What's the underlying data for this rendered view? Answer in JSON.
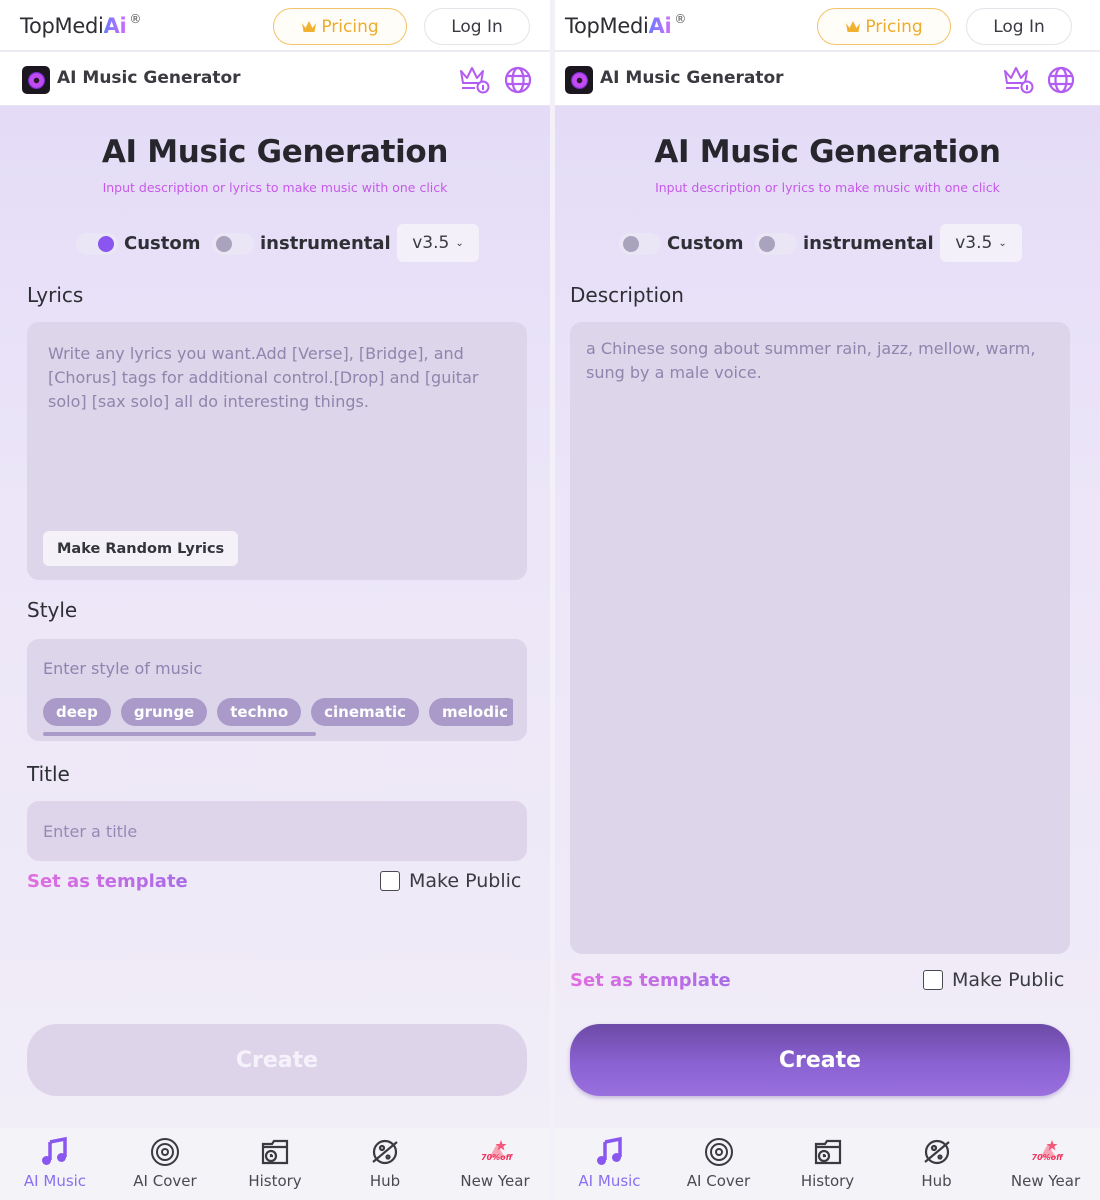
{
  "colors": {
    "accent": "#8a56f0",
    "pricing": "#eeab2e",
    "subtitle": "#c55ae8",
    "icon_purple": "#b35cf0",
    "promo_red": "#f0335c"
  },
  "header": {
    "logo_text": "TopMedi",
    "logo_ai": "Ai",
    "logo_mark": "®",
    "pricing_icon": "crown-icon",
    "pricing_label": "Pricing",
    "login_label": "Log In",
    "app_title": "AI Music Generator",
    "crown_info_icon": "crown-info-icon",
    "language_icon": "globe-icon"
  },
  "page": {
    "title": "AI Music Generation",
    "subtitle": "Input description or lyrics to make music with one click"
  },
  "left": {
    "custom_toggle": {
      "label": "Custom",
      "on": true
    },
    "instrumental_toggle": {
      "label": "instrumental",
      "on": false
    },
    "version": {
      "selected": "v3.5",
      "chevron": "⌄"
    },
    "lyrics": {
      "label": "Lyrics",
      "placeholder": "Write any lyrics you want.Add [Verse], [Bridge], and [Chorus] tags for additional control.[Drop] and [guitar solo] [sax solo] all do interesting things.",
      "random_button": "Make Random Lyrics"
    },
    "style": {
      "label": "Style",
      "placeholder": "Enter style of music",
      "chips": [
        "deep",
        "grunge",
        "techno",
        "cinematic",
        "melodic"
      ]
    },
    "title_field": {
      "label": "Title",
      "placeholder": "Enter a title"
    },
    "set_template": "Set as template",
    "make_public": {
      "label": "Make Public",
      "checked": false
    },
    "create_button": {
      "label": "Create",
      "enabled": false
    }
  },
  "right": {
    "custom_toggle": {
      "label": "Custom",
      "on": false
    },
    "instrumental_toggle": {
      "label": "instrumental",
      "on": false
    },
    "version": {
      "selected": "v3.5",
      "chevron": "⌄"
    },
    "description": {
      "label": "Description",
      "value": "a Chinese song about summer rain, jazz, mellow, warm, sung by a male voice."
    },
    "set_template": "Set as template",
    "make_public": {
      "label": "Make Public",
      "checked": false
    },
    "create_button": {
      "label": "Create",
      "enabled": true
    }
  },
  "bottom_nav": {
    "items": [
      {
        "label": "AI Music",
        "icon": "music-note-icon",
        "active": true
      },
      {
        "label": "AI Cover",
        "icon": "vinyl-disc-icon",
        "active": false
      },
      {
        "label": "History",
        "icon": "history-folder-icon",
        "active": false
      },
      {
        "label": "Hub",
        "icon": "planet-icon",
        "active": false
      },
      {
        "label": "New Year",
        "icon": "new-year-promo-icon",
        "active": false,
        "badge": "70%off"
      }
    ]
  }
}
